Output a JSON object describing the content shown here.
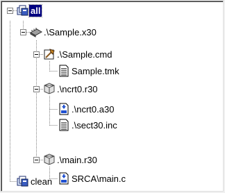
{
  "tree": {
    "root": {
      "label": "all",
      "icon": "target-group-icon",
      "selected": true
    },
    "nodes": [
      {
        "label": ".\\Sample.x30",
        "icon": "chip-icon"
      },
      {
        "label": ".\\Sample.cmd",
        "icon": "build-command-icon"
      },
      {
        "label": "Sample.tmk",
        "icon": "text-file-icon"
      },
      {
        "label": ".\\ncrt0.r30",
        "icon": "object-file-icon"
      },
      {
        "label": ".\\ncrt0.a30",
        "icon": "source-file-icon"
      },
      {
        "label": ".\\sect30.inc",
        "icon": "text-file-icon"
      },
      {
        "label": ".\\main.r30",
        "icon": "object-file-icon"
      },
      {
        "label": "SRCA\\main.c",
        "icon": "source-file-icon"
      },
      {
        "label": "clean",
        "icon": "target-group-icon"
      }
    ]
  },
  "colors": {
    "selection": "#000080",
    "tree_lines": "#808080"
  }
}
